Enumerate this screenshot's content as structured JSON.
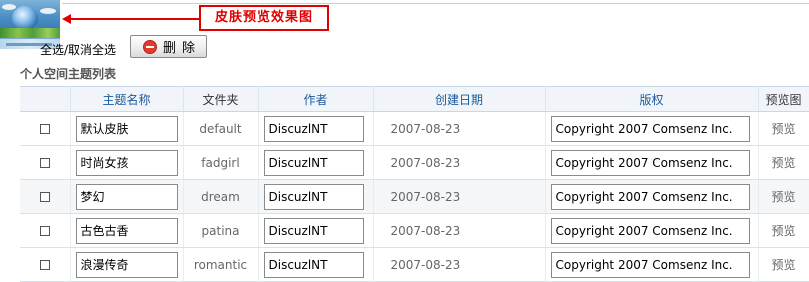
{
  "callout": {
    "text": "皮肤预览效果图"
  },
  "toolbar": {
    "select_all_label": "全选/取消全选",
    "delete_label": "删除"
  },
  "list": {
    "title": "个人空间主题列表",
    "columns": [
      "",
      "主题名称",
      "文件夹",
      "作者",
      "创建日期",
      "版权",
      "预览图"
    ],
    "rows": [
      {
        "name": "默认皮肤",
        "folder": "default",
        "author": "DiscuzlNT",
        "date": "2007-08-23",
        "copyright": "Copyright 2007 Comsenz Inc.",
        "preview": "预览"
      },
      {
        "name": "时尚女孩",
        "folder": "fadgirl",
        "author": "DiscuzlNT",
        "date": "2007-08-23",
        "copyright": "Copyright 2007 Comsenz Inc.",
        "preview": "预览"
      },
      {
        "name": "梦幻",
        "folder": "dream",
        "author": "DiscuzlNT",
        "date": "2007-08-23",
        "copyright": "Copyright 2007 Comsenz Inc.",
        "preview": "预览"
      },
      {
        "name": "古色古香",
        "folder": "patina",
        "author": "DiscuzlNT",
        "date": "2007-08-23",
        "copyright": "Copyright 2007 Comsenz Inc.",
        "preview": "预览"
      },
      {
        "name": "浪漫传奇",
        "folder": "romantic",
        "author": "DiscuzlNT",
        "date": "2007-08-23",
        "copyright": "Copyright 2007 Comsenz Inc.",
        "preview": "预览"
      }
    ]
  },
  "colors": {
    "callout_red": "#e00000",
    "header_text": "#1a5a9c",
    "header_bg": "#f1f5fa"
  },
  "icons": {
    "delete": "delete-icon",
    "arrow": "arrow-left-icon"
  }
}
